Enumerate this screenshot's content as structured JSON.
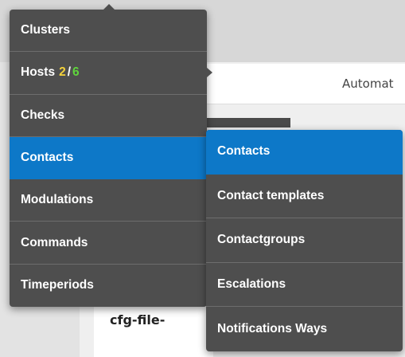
{
  "background": {
    "header_text": "Automat",
    "card_text": "cfg-file-"
  },
  "main_menu": {
    "items": [
      {
        "label": "Clusters"
      },
      {
        "label": "Hosts",
        "count_warning": "2",
        "count_separator": "/",
        "count_ok": "6"
      },
      {
        "label": "Checks"
      },
      {
        "label": "Contacts",
        "active": true
      },
      {
        "label": "Modulations"
      },
      {
        "label": "Commands"
      },
      {
        "label": "Timeperiods"
      }
    ]
  },
  "sub_menu": {
    "items": [
      {
        "label": "Contacts",
        "active": true
      },
      {
        "label": "Contact templates"
      },
      {
        "label": "Contactgroups"
      },
      {
        "label": "Escalations"
      },
      {
        "label": "Notifications Ways"
      }
    ]
  },
  "colors": {
    "menu_bg": "#4e4e4e",
    "active_bg": "#0d78c8",
    "warning_count": "#f4d23a",
    "ok_count": "#5fd53c"
  }
}
